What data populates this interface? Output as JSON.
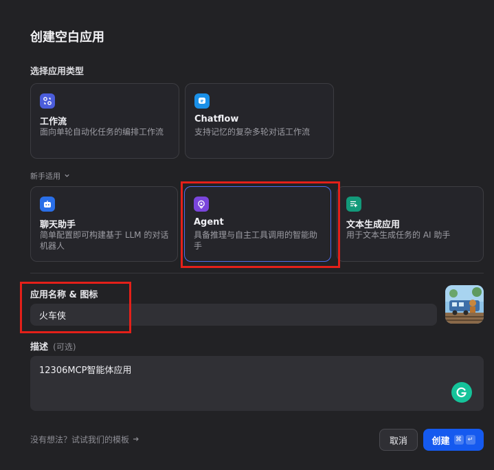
{
  "dialog": {
    "title": "创建空白应用",
    "type_section_label": "选择应用类型",
    "beginner_label": "新手适用",
    "colors": {
      "accent": "#155aef",
      "highlight": "#e42019",
      "selected_border": "#4e6ef0"
    }
  },
  "app_types_primary": [
    {
      "name": "工作流",
      "desc": "面向单轮自动化任务的编排工作流",
      "icon": "workflow-icon",
      "icon_color": "#4b5ddb"
    },
    {
      "name": "Chatflow",
      "desc": "支持记忆的复杂多轮对话工作流",
      "icon": "chatflow-icon",
      "icon_color": "#1a90e8"
    }
  ],
  "app_types_beginner": [
    {
      "name": "聊天助手",
      "desc": "简单配置即可构建基于 LLM 的对话机器人",
      "icon": "chat-assistant-icon",
      "icon_color": "#2a6fe8"
    },
    {
      "name": "Agent",
      "desc": "具备推理与自主工具调用的智能助手",
      "icon": "agent-icon",
      "icon_color": "#7a45dc",
      "selected": true
    },
    {
      "name": "文本生成应用",
      "desc": "用于文本生成任务的 AI 助手",
      "icon": "text-generator-icon",
      "icon_color": "#139a7a"
    }
  ],
  "name_field": {
    "label": "应用名称 & 图标",
    "value": "火车侠"
  },
  "description_field": {
    "label": "描述",
    "optional": "(可选)",
    "value": "12306MCP智能体应用"
  },
  "footer": {
    "template_link": "没有想法？试试我们的模板",
    "cancel_label": "取消",
    "create_label": "创建",
    "shortcut_cmd": "⌘",
    "shortcut_enter": "↵"
  }
}
